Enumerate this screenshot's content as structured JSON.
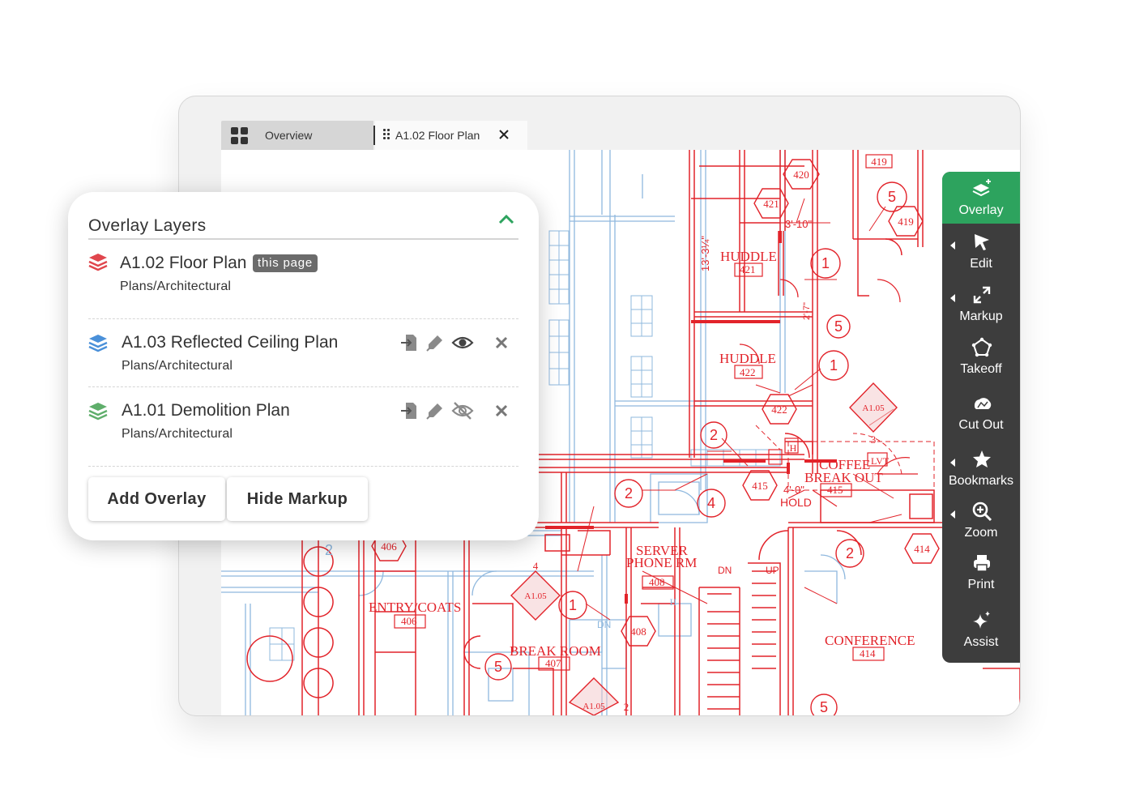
{
  "tabs": {
    "overview": "Overview",
    "active": "A1.02 Floor Plan"
  },
  "plan_labels": {
    "huddle_1": "HUDDLE",
    "huddle_1_no": "421",
    "huddle_2": "HUDDLE",
    "huddle_2_no": "422",
    "coffee": "COFFEE",
    "lvt": "LVT",
    "breakout": "BREAK OUT",
    "breakout_no": "415",
    "hold_dim": "4'-0\"",
    "hold": "HOLD",
    "server": "SERVER",
    "phone": "PHONE RM",
    "server_no": "408",
    "entry": "ENTRY/COATS",
    "entry_no": "406",
    "break_room": "BREAK ROOM",
    "break_no": "407",
    "conference": "CONFERENCE",
    "conf_no": "414",
    "dim_top": "3'-10\"",
    "dim_side": "13'-3¼\"",
    "dim_short": "2'-7\"",
    "dn_1": "DN",
    "up": "UP",
    "dn_2": "DN",
    "tag_420": "420",
    "tag_421": "421",
    "tag_419a": "419",
    "tag_419b": "419",
    "tag_422": "422",
    "tag_415": "415",
    "tag_414": "414",
    "tag_406": "406",
    "tag_408": "408",
    "c1a": "1",
    "c1b": "1",
    "c1c": "1",
    "c2a": "2",
    "c2b": "2",
    "c2c": "2",
    "c2d": "2",
    "c4": "4",
    "c5a": "5",
    "c5b": "5",
    "c5c": "5",
    "c5d": "5",
    "ref_1": "A1.05",
    "ref_2": "A1.05",
    "ref_3": "A1.05",
    "ref_n1": "3",
    "ref_n2": "4",
    "ref_n3": "2",
    "door_h1": "H",
    "door_h2": "H"
  },
  "toolbar": {
    "items": [
      {
        "label": "Overlay",
        "icon": "layers-plus-icon",
        "active": true
      },
      {
        "label": "Edit",
        "icon": "cursor-icon"
      },
      {
        "label": "Markup",
        "icon": "expand-arrows-icon"
      },
      {
        "label": "Takeoff",
        "icon": "polygon-icon"
      },
      {
        "label": "Cut Out",
        "icon": "cutout-icon"
      },
      {
        "label": "Bookmarks",
        "icon": "star-icon"
      },
      {
        "label": "Zoom",
        "icon": "zoom-in-icon"
      },
      {
        "label": "Print",
        "icon": "printer-icon"
      },
      {
        "label": "Assist",
        "icon": "sparkle-icon"
      }
    ]
  },
  "overlay_panel": {
    "title": "Overlay Layers",
    "layers": [
      {
        "name": "A1.02 Floor Plan",
        "badge": "this page",
        "path": "Plans/Architectural",
        "color": "#e0464d"
      },
      {
        "name": "A1.03 Reflected Ceiling Plan",
        "path": "Plans/Architectural",
        "color": "#4a90d9",
        "visible": true
      },
      {
        "name": "A1.01 Demolition Plan",
        "path": "Plans/Architectural",
        "color": "#5fae6b",
        "visible": false
      }
    ],
    "add_button": "Add Overlay",
    "hide_button": "Hide Markup"
  },
  "colors": {
    "accent": "#2da35e",
    "plan_red": "#e2232a",
    "plan_blue": "#8fb8de",
    "toolbar_bg": "#3d3d3d"
  }
}
